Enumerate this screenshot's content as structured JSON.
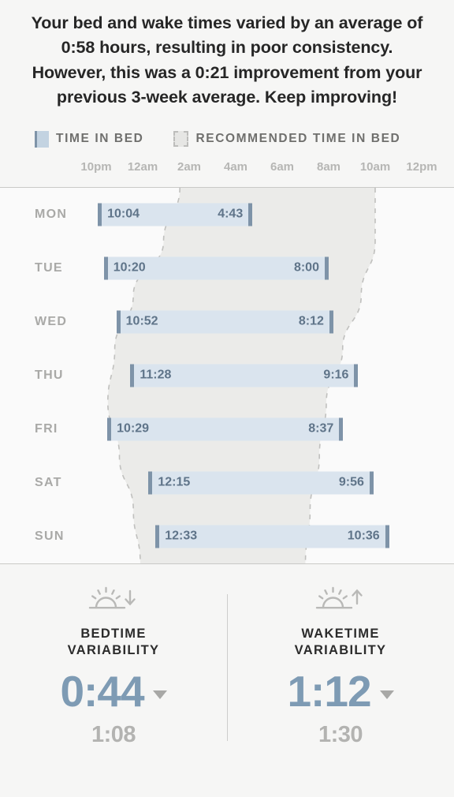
{
  "summary": {
    "text": "Your bed and wake times varied by an average of 0:58 hours, resulting in poor consistency. However, this was a 0:21 improvement from your previous 3-week average. Keep improving!"
  },
  "legend": {
    "items": [
      {
        "label": "TIME IN BED",
        "icon": "solid-swatch-icon",
        "color": "#c3d3e1"
      },
      {
        "label": "RECOMMENDED TIME IN BED",
        "icon": "dashed-swatch-icon",
        "color": "#e6e6e4"
      }
    ]
  },
  "chart_data": {
    "type": "bar",
    "title": "",
    "xlabel": "",
    "ylabel": "",
    "orientation": "horizontal",
    "grid": false,
    "legend_position": "top",
    "axis_ticks": [
      "10pm",
      "12am",
      "2am",
      "4am",
      "6am",
      "8am",
      "10am",
      "12pm"
    ],
    "axis_tick_hours": [
      22,
      24,
      26,
      28,
      30,
      32,
      34,
      36
    ],
    "xlim_hours": [
      22,
      36
    ],
    "categories": [
      "MON",
      "TUE",
      "WED",
      "THU",
      "FRI",
      "SAT",
      "SUN"
    ],
    "series": [
      {
        "name": "Time in bed",
        "color": "#dae4ee",
        "cap_color": "#7e93a8",
        "bars": [
          {
            "day": "MON",
            "start_label": "10:04",
            "end_label": "4:43",
            "start_hour": 22.07,
            "end_hour": 28.72
          },
          {
            "day": "TUE",
            "start_label": "10:20",
            "end_label": "8:00",
            "start_hour": 22.33,
            "end_hour": 32.0
          },
          {
            "day": "WED",
            "start_label": "10:52",
            "end_label": "8:12",
            "start_hour": 22.87,
            "end_hour": 32.2
          },
          {
            "day": "THU",
            "start_label": "11:28",
            "end_label": "9:16",
            "start_hour": 23.47,
            "end_hour": 33.27
          },
          {
            "day": "FRI",
            "start_label": "10:29",
            "end_label": "8:37",
            "start_hour": 22.48,
            "end_hour": 32.62
          },
          {
            "day": "SAT",
            "start_label": "12:15",
            "end_label": "9:56",
            "start_hour": 24.25,
            "end_hour": 33.93
          },
          {
            "day": "SUN",
            "start_label": "12:33",
            "end_label": "10:36",
            "start_hour": 24.55,
            "end_hour": 34.6
          }
        ]
      },
      {
        "name": "Recommended time in bed",
        "color": "#ebebe9",
        "border_style": "dashed",
        "border_color": "#c0c0be",
        "boundary_left_hours": [
          25.6,
          24.9,
          23.6,
          22.8,
          22.5,
          23.0,
          23.6,
          23.9
        ],
        "boundary_right_hours": [
          34.0,
          34.0,
          33.4,
          32.6,
          31.9,
          31.6,
          31.2,
          31.0
        ]
      }
    ]
  },
  "stats": [
    {
      "icon": "sunset-icon",
      "title_line1": "BEDTIME",
      "title_line2": "VARIABILITY",
      "value": "0:44",
      "caret": "chevron-down-icon",
      "sub_value": "1:08",
      "value_color": "#7e9bb4"
    },
    {
      "icon": "sunrise-icon",
      "title_line1": "WAKETIME",
      "title_line2": "VARIABILITY",
      "value": "1:12",
      "caret": "chevron-down-icon",
      "sub_value": "1:30",
      "value_color": "#7e9bb4"
    }
  ]
}
